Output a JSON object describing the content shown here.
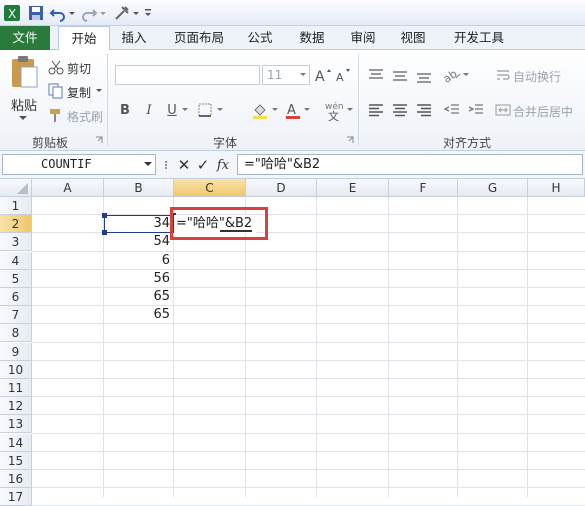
{
  "tabs": {
    "file": "文件",
    "items": [
      "开始",
      "插入",
      "页面布局",
      "公式",
      "数据",
      "审阅",
      "视图",
      "开发工具"
    ],
    "active_index": 0
  },
  "ribbon": {
    "clipboard": {
      "paste": "粘贴",
      "cut": "剪切",
      "copy": "复制",
      "format_painter": "格式刷",
      "label": "剪贴板"
    },
    "font": {
      "size": "11",
      "label": "字体"
    },
    "alignment": {
      "wrap": "自动换行",
      "merge": "合并后居中",
      "label": "对齐方式"
    }
  },
  "formula_bar": {
    "name_box": "COUNTIF",
    "fx": "fx",
    "formula": "=\"哈哈\"&B2"
  },
  "grid": {
    "columns": [
      "A",
      "B",
      "C",
      "D",
      "E",
      "F",
      "G",
      "H"
    ],
    "rows": [
      "1",
      "2",
      "3",
      "4",
      "5",
      "6",
      "7",
      "8",
      "9",
      "10",
      "11",
      "12",
      "13",
      "14",
      "15",
      "16",
      "17"
    ],
    "selected_column": "C",
    "selected_row": "2",
    "cells": {
      "B2": "34",
      "B3": "54",
      "B4": "6",
      "B5": "56",
      "B6": "65",
      "B7": "65",
      "C2": "=\"哈哈\"&B2"
    }
  },
  "colors": {
    "file_tab": "#2a7a3c",
    "highlight": "#d9413a",
    "selection": "#1f3d8a"
  }
}
